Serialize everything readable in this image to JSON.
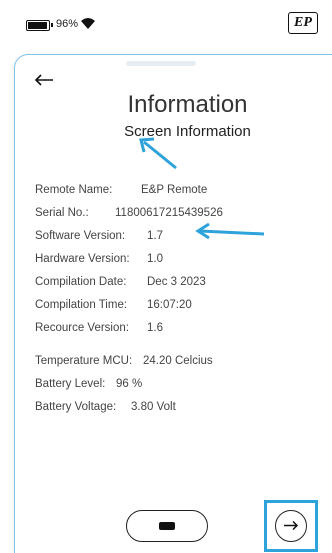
{
  "status_bar": {
    "battery_text": "96%",
    "battery_icon": "battery-icon",
    "wifi_icon": "wifi-icon",
    "logo_text": "EP"
  },
  "screen": {
    "title": "Information",
    "subtitle": "Screen Information",
    "back_icon": "arrow-left-icon",
    "rows": [
      {
        "label": "Remote Name:",
        "value": "E&P Remote"
      },
      {
        "label": "Serial No.:",
        "value": "11800617215439526"
      },
      {
        "label": "Software Version:",
        "value": "1.7"
      },
      {
        "label": "Hardware Version:",
        "value": "1.0"
      },
      {
        "label": "Compilation Date:",
        "value": "Dec 3 2023"
      },
      {
        "label": "Compilation Time:",
        "value": "16:07:20"
      },
      {
        "label": "Recource Version:",
        "value": "1.6"
      },
      {
        "label": "Temperature MCU:",
        "value": "24.20 Celcius"
      },
      {
        "label": "Battery Level:",
        "value": "96 %"
      },
      {
        "label": "Battery Voltage:",
        "value": "3.80 Volt"
      }
    ],
    "home_icon": "home-pill-icon",
    "next_icon": "arrow-right-icon"
  },
  "colors": {
    "annotation_blue": "#2ea3db",
    "screen_border": "#7fc3e8"
  }
}
